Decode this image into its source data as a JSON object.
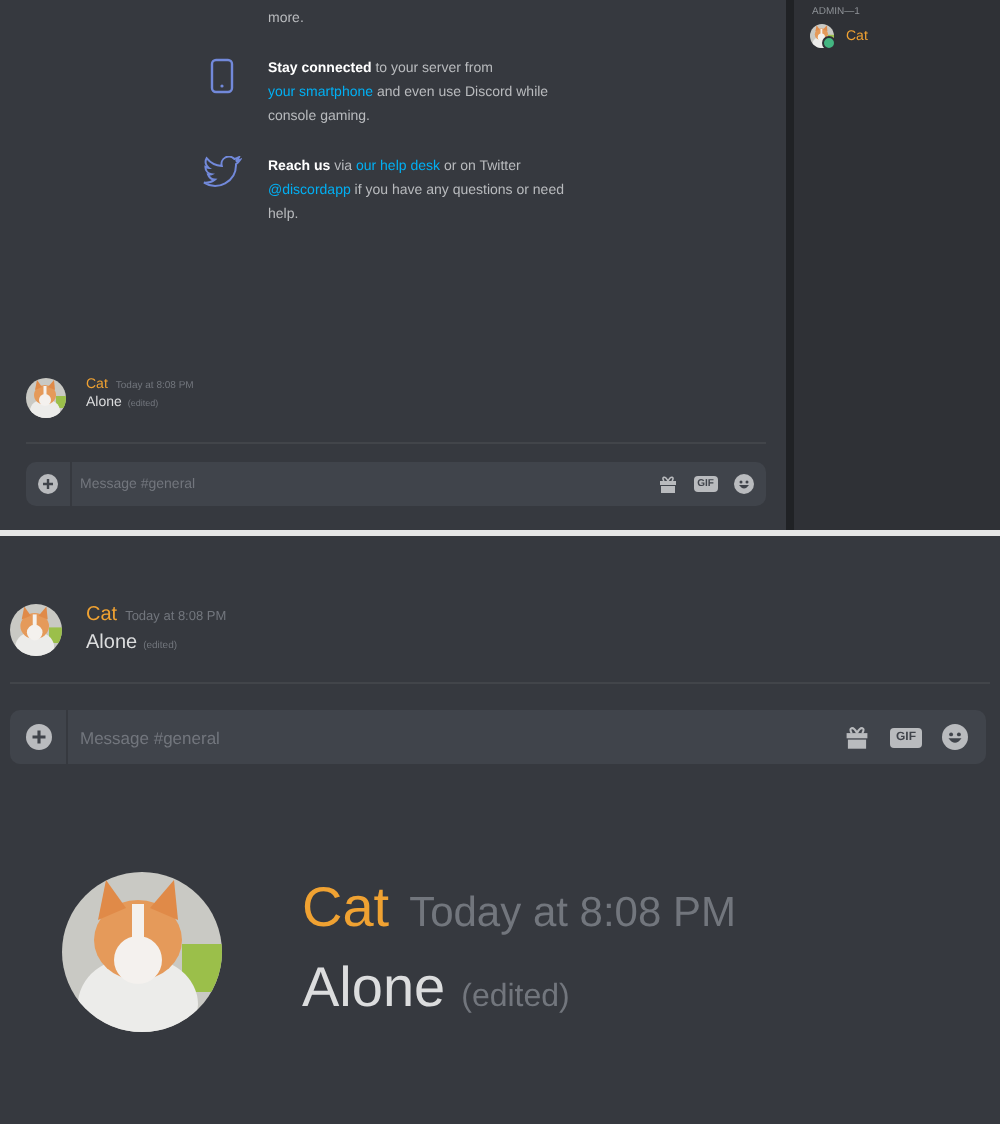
{
  "top_window": {
    "features": [
      {
        "kind": "none",
        "segments": [
          {
            "kind": "plain",
            "text": "more."
          }
        ]
      },
      {
        "kind": "phone",
        "segments": [
          {
            "kind": "bold",
            "text": "Stay connected"
          },
          {
            "kind": "plain",
            "text": " to your server from "
          },
          {
            "kind": "link",
            "text": "your smartphone"
          },
          {
            "kind": "plain",
            "text": " and even use Discord while console gaming."
          }
        ]
      },
      {
        "kind": "twitter",
        "segments": [
          {
            "kind": "bold",
            "text": "Reach us"
          },
          {
            "kind": "plain",
            "text": " via "
          },
          {
            "kind": "link",
            "text": "our help desk"
          },
          {
            "kind": "plain",
            "text": " or on Twitter "
          },
          {
            "kind": "link",
            "text": "@discordapp"
          },
          {
            "kind": "plain",
            "text": " if you have any questions or need help."
          }
        ]
      }
    ],
    "message": {
      "author": "Cat",
      "timestamp": "Today at 8:08 PM",
      "text": "Alone",
      "edited_label": "(edited)"
    },
    "composer": {
      "placeholder": "Message #general",
      "gif_label": "GIF"
    },
    "member_list": {
      "heading": "ADMIN—1",
      "members": [
        {
          "name": "Cat",
          "color": "#43b581"
        }
      ]
    }
  },
  "middle_window": {
    "message": {
      "author": "Cat",
      "timestamp": "Today at 8:08 PM",
      "text": "Alone",
      "edited_label": "(edited)"
    },
    "composer": {
      "placeholder": "Message #general",
      "gif_label": "GIF"
    }
  },
  "zoomed_message": {
    "author": "Cat",
    "timestamp": "Today at 8:08 PM",
    "text": "Alone",
    "edited_label": "(edited)"
  }
}
